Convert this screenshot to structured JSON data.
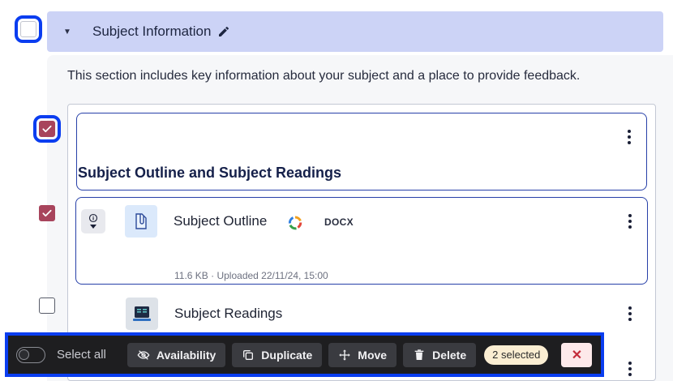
{
  "section": {
    "title": "Subject Information",
    "description": "This section includes key information about your subject and a place to provide feedback."
  },
  "items": [
    {
      "type": "heading",
      "title": "Subject Outline and Subject Readings",
      "checked": true
    },
    {
      "type": "file",
      "title": "Subject Outline",
      "file_type": "DOCX",
      "meta": "11.6 KB · Uploaded 22/11/24, 15:00",
      "checked": true
    },
    {
      "type": "file",
      "title": "Subject Readings",
      "checked": false
    }
  ],
  "toolbar": {
    "select_all_label": "Select all",
    "availability_label": "Availability",
    "duplicate_label": "Duplicate",
    "move_label": "Move",
    "delete_label": "Delete",
    "selected_badge": "2 selected",
    "close_label": "✕"
  },
  "colors": {
    "accent_header": "#ccd3f6",
    "checked": "#a8445c",
    "focus_outline": "#0a3df0",
    "toolbar_bg": "#1e1e20"
  },
  "icons": [
    "chevron-down-icon",
    "pencil-icon",
    "kebab-icon",
    "info-icon",
    "attachment-icon",
    "app-badge-icon",
    "book-icon",
    "eye-off-icon",
    "duplicate-icon",
    "move-icon",
    "trash-icon",
    "close-icon"
  ]
}
